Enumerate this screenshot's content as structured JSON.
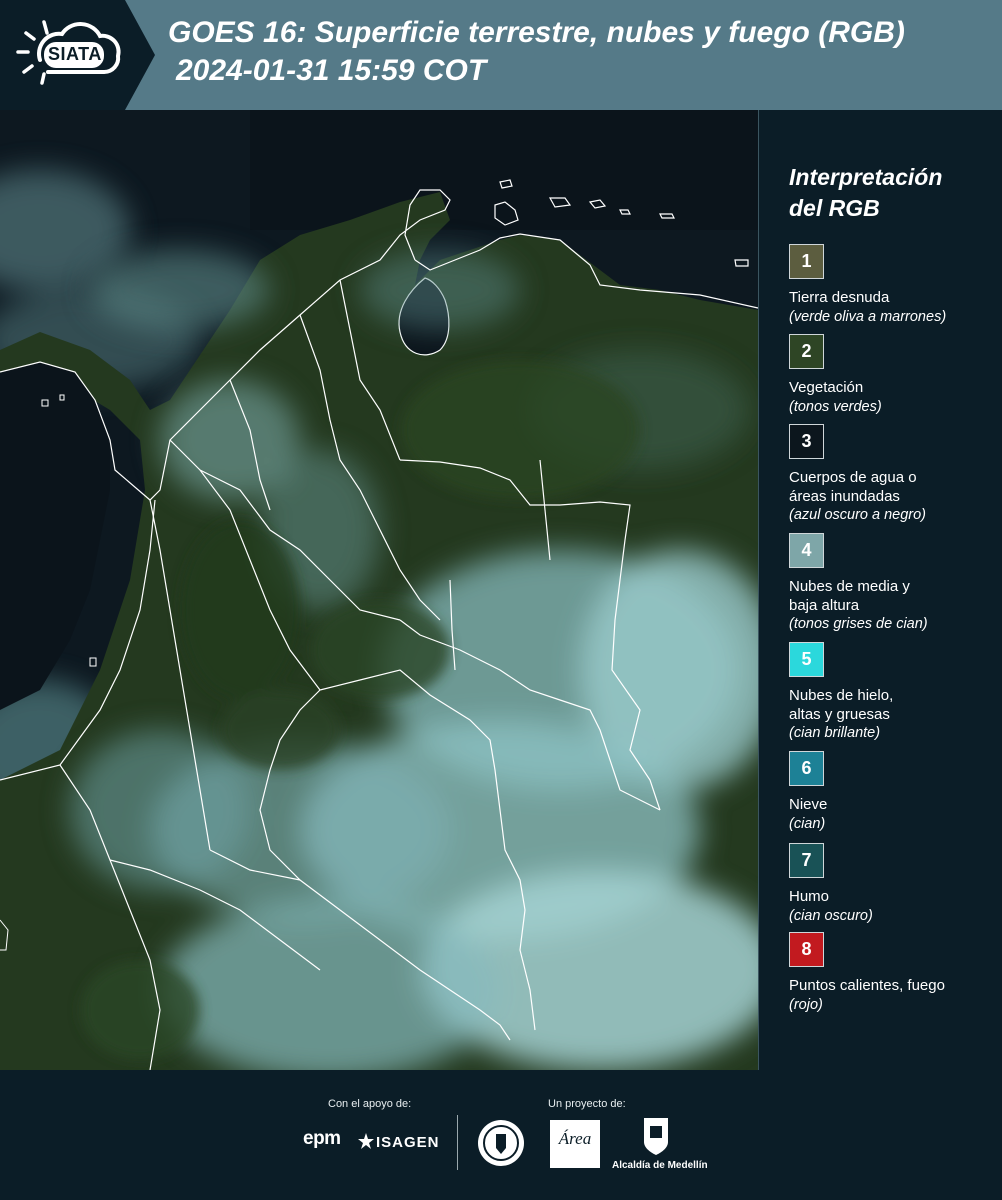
{
  "header": {
    "logo_text": "SIATA",
    "title": "GOES 16: Superficie terrestre, nubes y fuego (RGB)",
    "subtitle": "2024-01-31 15:59 COT"
  },
  "legend": {
    "title_line1": "Interpretación",
    "title_line2": "del RGB",
    "items": [
      {
        "number": "1",
        "color": "#5c5d3f",
        "label_line1": "Tierra desnuda",
        "label_line2": "",
        "desc": "(verde oliva a marrones)"
      },
      {
        "number": "2",
        "color": "#2e4525",
        "label_line1": "Vegetación",
        "label_line2": "",
        "desc": "(tonos verdes)"
      },
      {
        "number": "3",
        "color": "#0c161d",
        "label_line1": "Cuerpos de agua o",
        "label_line2": "áreas inundadas",
        "desc": "(azul oscuro a negro)"
      },
      {
        "number": "4",
        "color": "#7ea6a8",
        "label_line1": "Nubes de media y",
        "label_line2": "baja altura",
        "desc": "(tonos grises de cian)"
      },
      {
        "number": "5",
        "color": "#2bd8dc",
        "label_line1": "Nubes de hielo,",
        "label_line2": "altas y gruesas",
        "desc": "(cian brillante)"
      },
      {
        "number": "6",
        "color": "#1d8196",
        "label_line1": "Nieve",
        "label_line2": "",
        "desc": "(cian)"
      },
      {
        "number": "7",
        "color": "#195256",
        "label_line1": "Humo",
        "label_line2": "",
        "desc": "(cian oscuro)"
      },
      {
        "number": "8",
        "color": "#c21a1f",
        "label_line1": "Puntos calientes, fuego",
        "label_line2": "",
        "desc": "(rojo)"
      }
    ]
  },
  "footer": {
    "support_caption": "Con el apoyo de:",
    "project_caption": "Un proyecto de:",
    "sponsor_epm": "epm",
    "sponsor_isagen": "ISAGEN",
    "partner_area": "Área",
    "partner_alcaldia": "Alcaldía de Medellín"
  },
  "colors": {
    "header_bg": "#557a88",
    "logo_bg": "#0b1d27",
    "page_bg": "#0b1d27",
    "cloud": "#8fc3c6",
    "vegetation": "#2e4525",
    "water": "#0c161d",
    "border": "#ffffff"
  }
}
